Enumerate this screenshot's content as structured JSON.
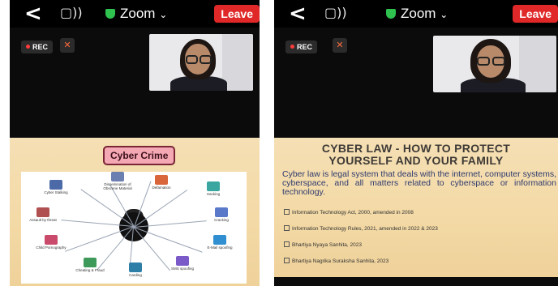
{
  "left_panel": {
    "topbar": {
      "back_glyph": "<",
      "speaker_glyph": "▢))",
      "app_label": "Zoom",
      "chevron": "⌄",
      "leave_label": "Leave"
    },
    "rec_label": "REC",
    "slide": {
      "title": "Cyber Crime",
      "nodes": [
        "Dissemination of Obscene Material",
        "Defamation",
        "Hacking",
        "Cracking",
        "E-Mail spoofing",
        "SMS spoofing",
        "Carding",
        "Cheating & Fraud",
        "Child Pornography",
        "Assault by threat",
        "Cyber Stalking"
      ]
    }
  },
  "right_panel": {
    "topbar": {
      "back_glyph": "<",
      "speaker_glyph": "▢))",
      "app_label": "Zoom",
      "chevron": "⌄",
      "leave_label": "Leave"
    },
    "rec_label": "REC",
    "slide": {
      "title_line1": "CYBER LAW - HOW TO PROTECT",
      "title_line2": "YOURSELF AND YOUR FAMILY",
      "body": "Cyber law is legal system that deals with the internet, computer systems, cyberspace, and all matters related to cyberspace or information technology.",
      "items": [
        "Information Technology Act, 2000, amended in 2008",
        "Information Technology Rules, 2021, amended in 2022 & 2023",
        "Bhartiya Nyaya Sanhita, 2023",
        "Bhartiya Nagrika Suraksha Sanhita, 2023"
      ]
    }
  },
  "colors": {
    "leave": "#e02828",
    "shield": "#2fc24f",
    "rec_dot": "#ff3b3b",
    "title_box": "#f4a8b4",
    "slide_bg": "#f3d9a5"
  }
}
